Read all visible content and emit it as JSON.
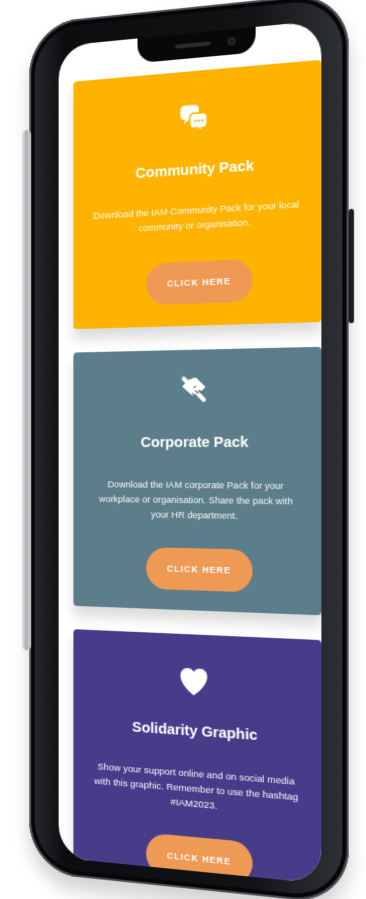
{
  "cards": [
    {
      "title": "Community Pack",
      "description": "Download the IAM Community Pack for your local community or organisation.",
      "button_label": "CLICK HERE",
      "icon": "chat-bubbles-icon",
      "background_color": "#fdb300"
    },
    {
      "title": "Corporate Pack",
      "description": "Download the IAM corporate Pack for your workplace or organisation. Share the pack with your HR department.",
      "button_label": "CLICK HERE",
      "icon": "handshake-icon",
      "background_color": "#5c7d8a"
    },
    {
      "title": "Solidarity Graphic",
      "description": "Show your support online and on social media with this graphic. Remember to use the hashtag #IAM2023.",
      "button_label": "CLICK HERE",
      "icon": "heart-icon",
      "background_color": "#463c8a"
    }
  ],
  "accent_button_color": "#ee9a55"
}
